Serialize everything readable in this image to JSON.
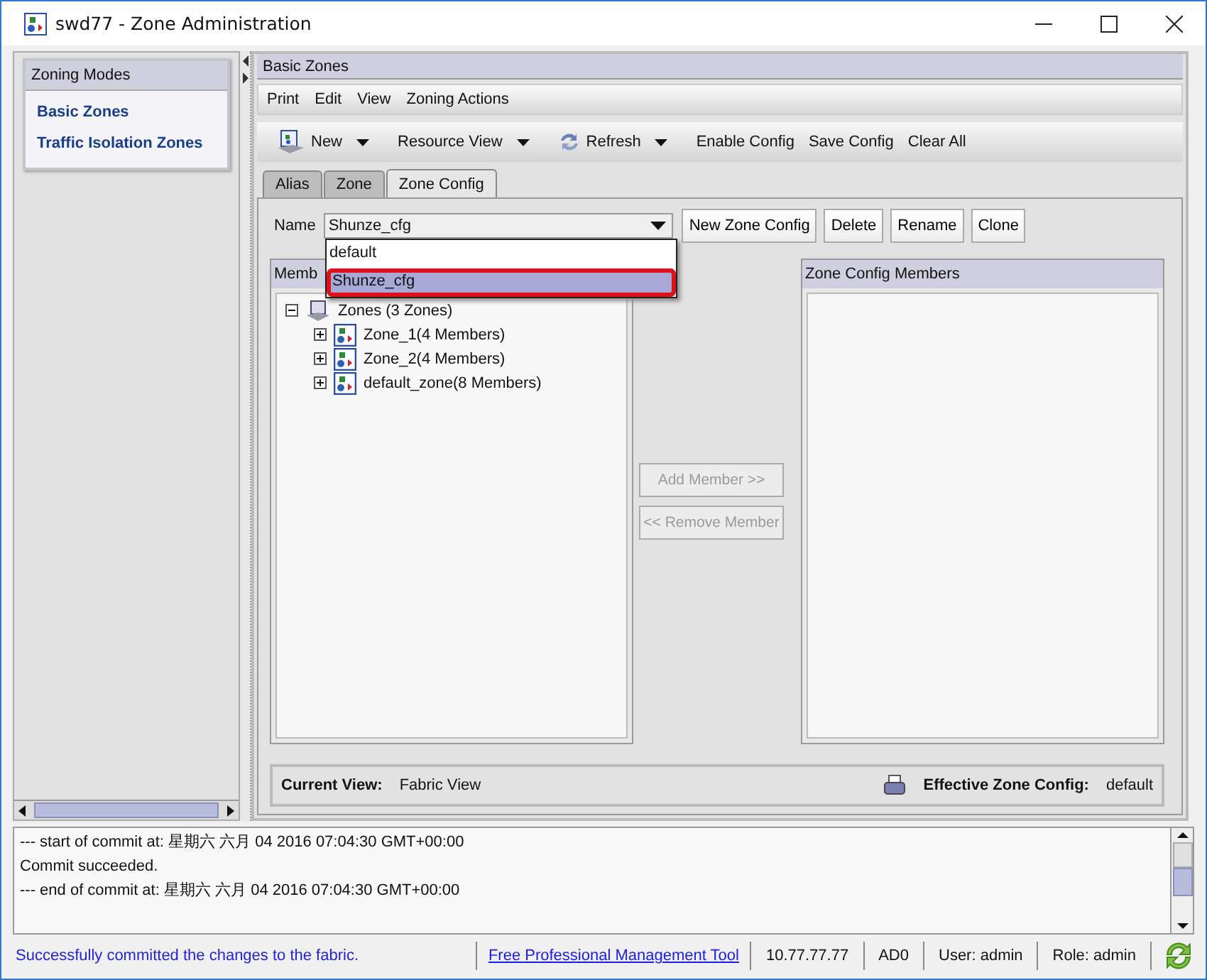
{
  "window": {
    "title": "swd77 - Zone Administration"
  },
  "zoning_modes": {
    "title": "Zoning Modes",
    "items": [
      {
        "label": "Basic Zones"
      },
      {
        "label": "Traffic Isolation Zones"
      }
    ]
  },
  "panel": {
    "title": "Basic Zones"
  },
  "menu": [
    "Print",
    "Edit",
    "View",
    "Zoning Actions"
  ],
  "toolbar": [
    {
      "label": "New",
      "kind": "new",
      "dropdown": true
    },
    {
      "label": "Resource View",
      "kind": "text",
      "dropdown": true
    },
    {
      "label": "Refresh",
      "kind": "refresh",
      "dropdown": true
    },
    {
      "label": "Enable Config",
      "kind": "text",
      "dropdown": false
    },
    {
      "label": "Save Config",
      "kind": "text",
      "dropdown": false
    },
    {
      "label": "Clear All",
      "kind": "text",
      "dropdown": false
    }
  ],
  "tabs": [
    {
      "label": "Alias",
      "selected": false
    },
    {
      "label": "Zone",
      "selected": false
    },
    {
      "label": "Zone Config",
      "selected": true
    }
  ],
  "name_field": {
    "label": "Name",
    "value": "Shunze_cfg",
    "options": [
      {
        "label": "default",
        "selected": false
      },
      {
        "label": "Shunze_cfg",
        "selected": true
      }
    ]
  },
  "config_buttons": [
    "New Zone Config",
    "Delete",
    "Rename",
    "Clone"
  ],
  "members": {
    "title": "Memb",
    "tree": [
      {
        "label": "Zones (3 Zones)",
        "kind": "group",
        "expanded": true,
        "children": [
          {
            "label": "Zone_1(4 Members)",
            "kind": "zone",
            "expanded": false
          },
          {
            "label": "Zone_2(4 Members)",
            "kind": "zone",
            "expanded": false
          },
          {
            "label": "default_zone(8 Members)",
            "kind": "zone",
            "expanded": false
          }
        ]
      }
    ]
  },
  "transfer_buttons": [
    {
      "label": "Add Member >>",
      "disabled": true
    },
    {
      "label": "<< Remove Member",
      "disabled": true
    }
  ],
  "config_members": {
    "title": "Zone Config Members"
  },
  "footer": {
    "current_view_label": "Current View:",
    "current_view": "Fabric View",
    "effective_label": "Effective Zone Config:",
    "effective": "default"
  },
  "log": [
    "--- start of commit at: 星期六 六月 04 2016 07:04:30 GMT+00:00",
    "Commit succeeded.",
    "--- end of commit at: 星期六 六月 04 2016 07:04:30 GMT+00:00"
  ],
  "status_bar": {
    "message": "Successfully committed the changes to the fabric.",
    "link": "Free Professional Management Tool",
    "fields": [
      "10.77.77.77",
      "AD0",
      "User: admin",
      "Role: admin"
    ]
  }
}
